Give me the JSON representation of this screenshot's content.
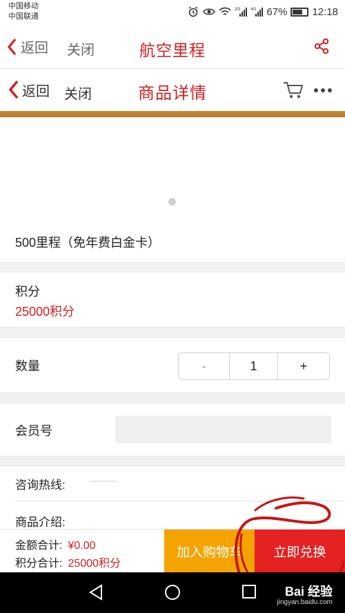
{
  "status_bar": {
    "carrier1": "中国移动",
    "carrier2": "中国联通",
    "net1": "2G",
    "net2": "4G",
    "battery": "67%",
    "time": "12:18"
  },
  "outer_nav": {
    "back_label": "返回",
    "close_label": "关闭",
    "title": "航空里程"
  },
  "inner_nav": {
    "back_label": "返回",
    "close_label": "关闭",
    "title": "商品详情"
  },
  "product": {
    "name": "500里程（免年费白金卡）"
  },
  "points": {
    "label": "积分",
    "value": "25000积分"
  },
  "quantity": {
    "label": "数量",
    "minus": "-",
    "value": "1",
    "plus": "+"
  },
  "member": {
    "label": "会员号",
    "value": ""
  },
  "hotline": {
    "label": "咨询热线:"
  },
  "intro": {
    "label": "商品介绍:"
  },
  "summary": {
    "amount_label": "金额合计:",
    "amount_value": "¥0.00",
    "points_label": "积分合计:",
    "points_value": "25000积分"
  },
  "actions": {
    "add_cart": "加入购物车",
    "redeem": "立即兑换"
  },
  "watermark": {
    "text": "Bai 经验",
    "sub": "jingyan.baidu.com"
  },
  "colors": {
    "accent": "#d11e1e",
    "cart_button": "#f5a300",
    "redeem_button": "#e42222",
    "gold_bar": "#c58a3a"
  }
}
